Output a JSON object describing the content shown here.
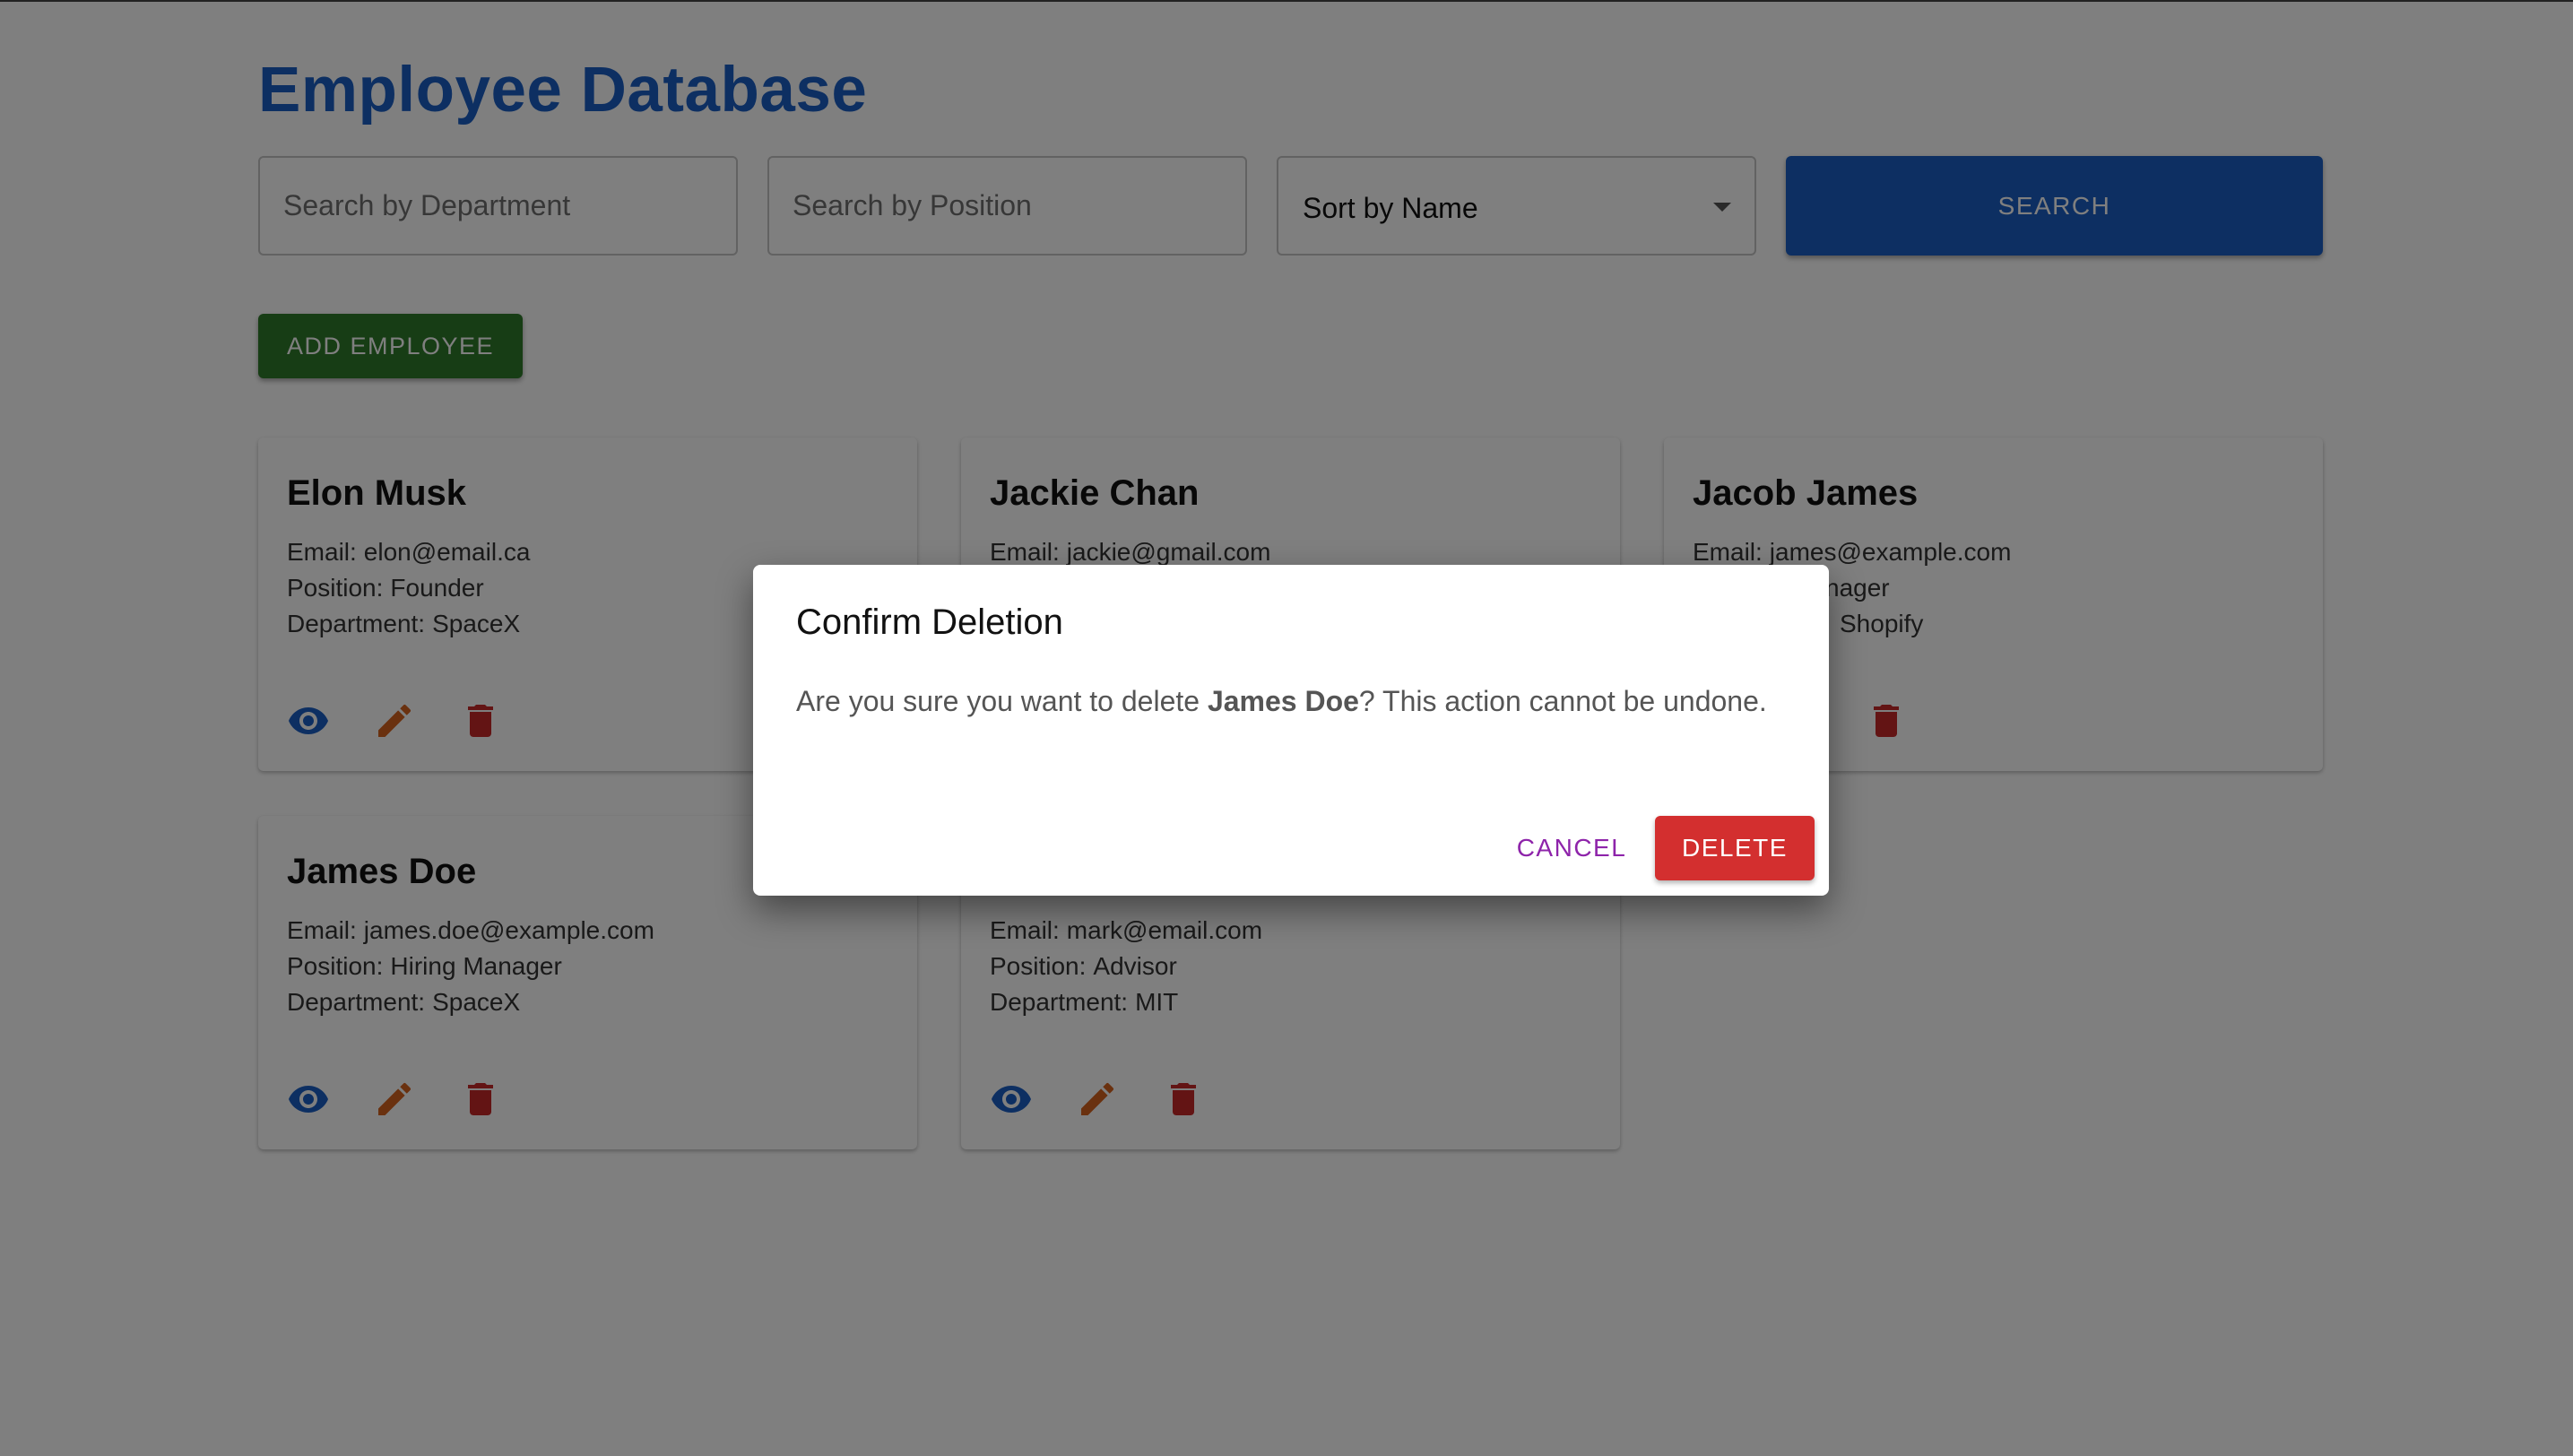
{
  "page": {
    "title": "Employee Database"
  },
  "filters": {
    "department_placeholder": "Search by Department",
    "position_placeholder": "Search by Position",
    "sort_selected": "Sort by Name",
    "search_label": "SEARCH"
  },
  "actions": {
    "add_label": "ADD EMPLOYEE"
  },
  "labels": {
    "email": "Email:",
    "position": "Position:",
    "department": "Department:"
  },
  "employees": [
    {
      "name": "Elon Musk",
      "email": "elon@email.ca",
      "position": "Founder",
      "department": "SpaceX"
    },
    {
      "name": "Jackie Chan",
      "email": "jackie@gmail.com",
      "position": "",
      "department": ""
    },
    {
      "name": "Jacob James",
      "email": "james@example.com",
      "position": "nager",
      "department": "Shopify"
    },
    {
      "name": "James Doe",
      "email": "james.doe@example.com",
      "position": "Hiring Manager",
      "department": "SpaceX"
    },
    {
      "name": "",
      "email": "mark@email.com",
      "position": "Advisor",
      "department": "MIT"
    }
  ],
  "dialog": {
    "title": "Confirm Deletion",
    "message_prefix": "Are you sure you want to delete ",
    "target_name": "James Doe",
    "message_suffix": "? This action cannot be undone.",
    "cancel_label": "CANCEL",
    "delete_label": "DELETE"
  },
  "icons": {
    "view": "eye-icon",
    "edit": "pencil-icon",
    "delete": "trash-icon"
  },
  "colors": {
    "title": "#1b5fc4",
    "search_button": "#1b5fc4",
    "add_button": "#2f7a2b",
    "view_icon": "#1b5fc4",
    "edit_icon": "#d4621e",
    "delete_icon": "#c62828",
    "delete_button": "#d32f2f",
    "cancel_text": "#8e24aa"
  }
}
